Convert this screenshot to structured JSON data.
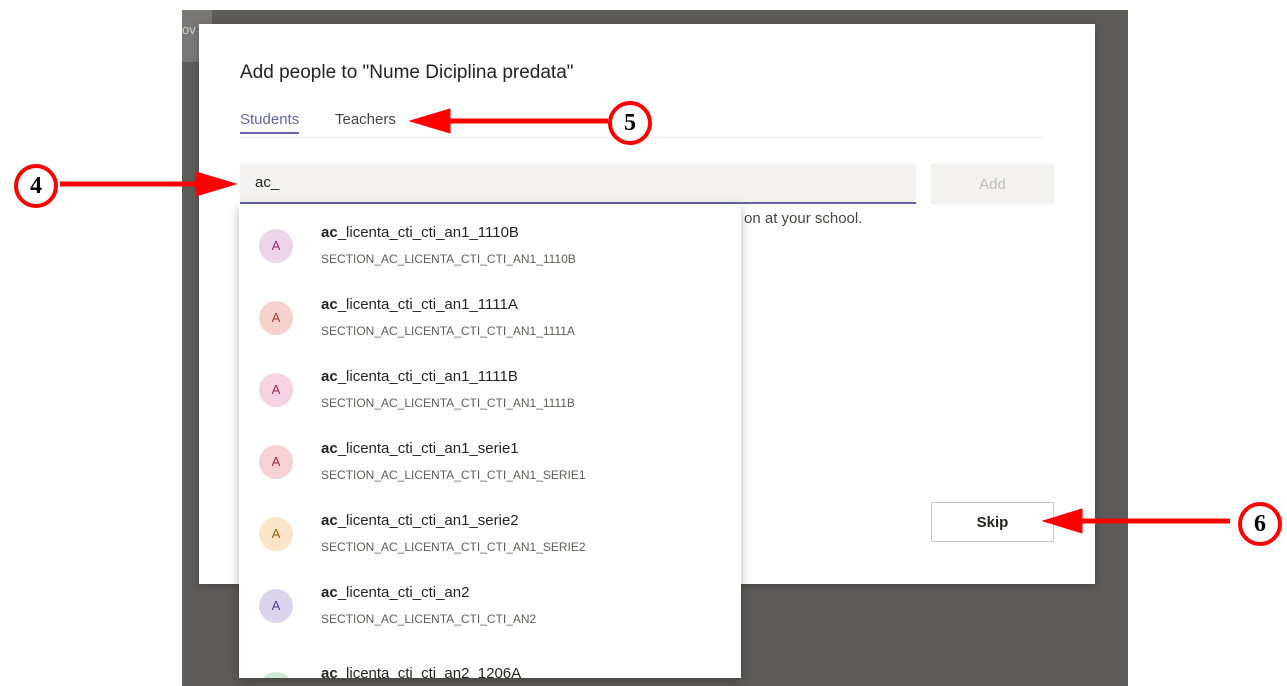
{
  "backdrop": {
    "peek_text": "ov"
  },
  "dialog": {
    "title": "Add people to \"Nume Diciplina predata\"",
    "tabs": [
      {
        "label": "Students",
        "active": true
      },
      {
        "label": "Teachers",
        "active": false
      }
    ],
    "search": {
      "value": "ac_"
    },
    "add_label": "Add",
    "hint_text": "on at your school.",
    "skip_label": "Skip"
  },
  "suggestions": [
    {
      "bold": "ac",
      "rest": "_licenta_cti_cti_an1_1110B",
      "sub": "SECTION_AC_LICENTA_CTI_CTI_AN1_1110B",
      "initial": "A",
      "bg": "#ecd5e8",
      "fg": "#8a2f72"
    },
    {
      "bold": "ac",
      "rest": "_licenta_cti_cti_an1_1111A",
      "sub": "SECTION_AC_LICENTA_CTI_CTI_AN1_1111A",
      "initial": "A",
      "bg": "#f5d2cb",
      "fg": "#a03a2b"
    },
    {
      "bold": "ac",
      "rest": "_licenta_cti_cti_an1_1111B",
      "sub": "SECTION_AC_LICENTA_CTI_CTI_AN1_1111B",
      "initial": "A",
      "bg": "#f6d3e1",
      "fg": "#a4264f"
    },
    {
      "bold": "ac",
      "rest": "_licenta_cti_cti_an1_serie1",
      "sub": "SECTION_AC_LICENTA_CTI_CTI_AN1_SERIE1",
      "initial": "A",
      "bg": "#f6d2d6",
      "fg": "#a5263a"
    },
    {
      "bold": "ac",
      "rest": "_licenta_cti_cti_an1_serie2",
      "sub": "SECTION_AC_LICENTA_CTI_CTI_AN1_SERIE2",
      "initial": "A",
      "bg": "#fbe5c9",
      "fg": "#9b5a12"
    },
    {
      "bold": "ac",
      "rest": "_licenta_cti_cti_an2",
      "sub": "SECTION_AC_LICENTA_CTI_CTI_AN2",
      "initial": "A",
      "bg": "#dcd4ec",
      "fg": "#4f3a8a"
    },
    {
      "bold": "ac",
      "rest": "_licenta_cti_cti_an2_1206A",
      "sub": "",
      "initial": "",
      "bg": "#cfe6d6",
      "fg": "#2f6b43"
    }
  ],
  "markers": [
    {
      "label": "4"
    },
    {
      "label": "5"
    },
    {
      "label": "6"
    }
  ],
  "colors": {
    "accent": "#6264a7",
    "annotation": "#ff0000",
    "backdrop": "#5d5b5a"
  }
}
